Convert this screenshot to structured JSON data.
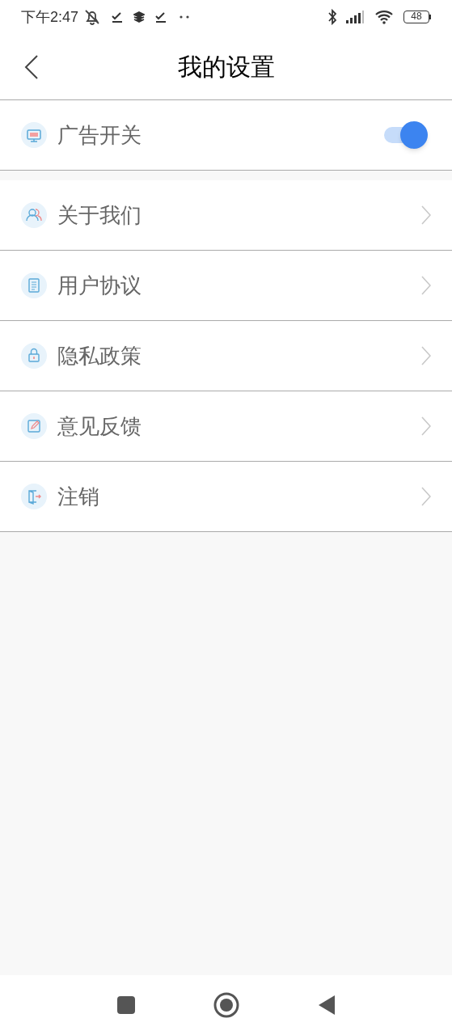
{
  "status_bar": {
    "time": "下午2:47",
    "battery": "48"
  },
  "header": {
    "title": "我的设置"
  },
  "toggle_row": {
    "label": "广告开关",
    "on": true
  },
  "menu_items": [
    {
      "label": "关于我们",
      "kind": "people"
    },
    {
      "label": "用户协议",
      "kind": "document"
    },
    {
      "label": "隐私政策",
      "kind": "lock"
    },
    {
      "label": "意见反馈",
      "kind": "edit"
    },
    {
      "label": "注销",
      "kind": "exit"
    }
  ]
}
